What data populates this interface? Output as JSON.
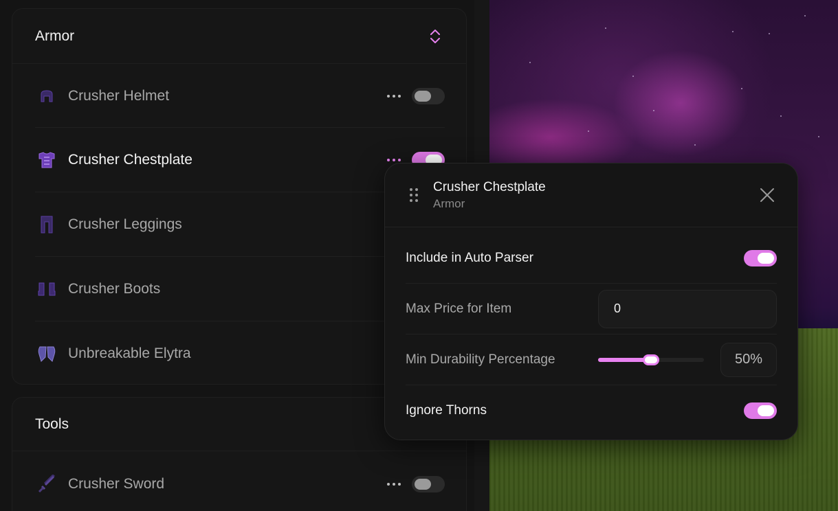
{
  "colors": {
    "accent": "#e682ef",
    "panel": "#161616",
    "toggle_off": "#2b2b2b"
  },
  "armor_section": {
    "title": "Armor",
    "sort_icon": "chevron-up-down-icon",
    "items": [
      {
        "label": "Crusher Helmet",
        "icon": "helmet-icon",
        "enabled": false,
        "active": false
      },
      {
        "label": "Crusher Chestplate",
        "icon": "chestplate-icon",
        "enabled": true,
        "active": true
      },
      {
        "label": "Crusher Leggings",
        "icon": "leggings-icon",
        "enabled": false,
        "active": false
      },
      {
        "label": "Crusher Boots",
        "icon": "boots-icon",
        "enabled": false,
        "active": false
      },
      {
        "label": "Unbreakable Elytra",
        "icon": "elytra-icon",
        "enabled": false,
        "active": false
      }
    ]
  },
  "tools_section": {
    "title": "Tools",
    "items": [
      {
        "label": "Crusher Sword",
        "icon": "sword-icon",
        "enabled": false,
        "active": false
      }
    ]
  },
  "popup": {
    "title": "Crusher Chestplate",
    "subtitle": "Armor",
    "settings": {
      "auto_parser": {
        "label": "Include in Auto Parser",
        "enabled": true
      },
      "max_price": {
        "label": "Max Price for Item",
        "value": "0"
      },
      "min_durability": {
        "label": "Min Durability Percentage",
        "value": 50,
        "display": "50%"
      },
      "ignore_thorns": {
        "label": "Ignore Thorns",
        "enabled": true
      }
    }
  }
}
